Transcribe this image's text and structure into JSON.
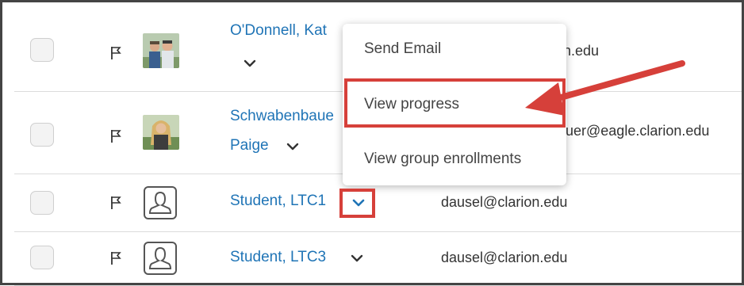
{
  "rows": [
    {
      "name_line1": "O'Donnell, Kat",
      "name_line2": "",
      "email": "on.edu"
    },
    {
      "name_line1": "Schwabenbaue",
      "name_line2": "Paige",
      "email": "uer@eagle.clarion.edu"
    },
    {
      "name_line1": "Student, LTC1",
      "name_line2": "",
      "email": "dausel@clarion.edu"
    },
    {
      "name_line1": "Student, LTC3",
      "name_line2": "",
      "email": "dausel@clarion.edu"
    }
  ],
  "context_menu": {
    "items": [
      "Send Email",
      "View progress",
      "View group enrollments"
    ]
  },
  "colors": {
    "link": "#1f74b6",
    "highlight": "#d6403a"
  },
  "icons": {
    "flag": "flag-icon",
    "chevron": "chevron-down-icon",
    "profile": "user-placeholder-icon"
  }
}
